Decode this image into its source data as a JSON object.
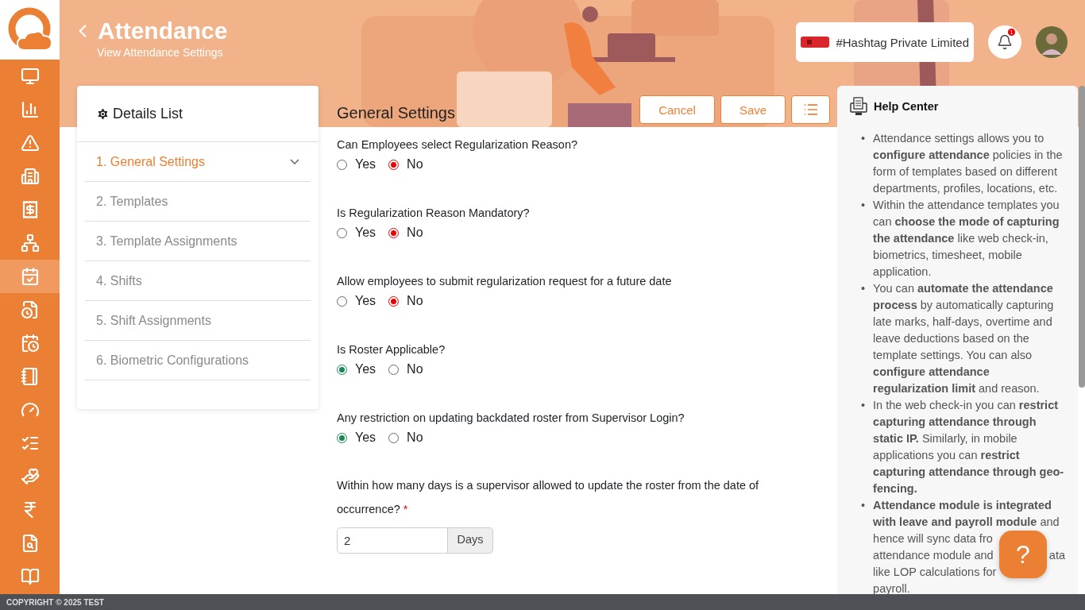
{
  "header": {
    "title": "Attendance",
    "subtitle": "View Attendance Settings",
    "company": "#Hashtag Private Limited",
    "notification_count": "1"
  },
  "nav_items": [
    {
      "selected": false
    },
    {
      "selected": false
    },
    {
      "selected": false
    },
    {
      "selected": false
    },
    {
      "selected": false
    },
    {
      "selected": false
    },
    {
      "selected": true
    },
    {
      "selected": false
    },
    {
      "selected": false
    },
    {
      "selected": false
    },
    {
      "selected": false
    },
    {
      "selected": false
    },
    {
      "selected": false
    },
    {
      "selected": false
    },
    {
      "selected": false
    },
    {
      "selected": false
    }
  ],
  "details": {
    "title": "Details List",
    "items": [
      {
        "label": "1. General Settings",
        "selected": true
      },
      {
        "label": "2. Templates",
        "selected": false
      },
      {
        "label": "3. Template Assignments",
        "selected": false
      },
      {
        "label": "4. Shifts",
        "selected": false
      },
      {
        "label": "5. Shift Assignments",
        "selected": false
      },
      {
        "label": "6. Biometric Configurations",
        "selected": false
      }
    ]
  },
  "form": {
    "title": "General Settings",
    "buttons": [
      "Cancel",
      "Save"
    ],
    "questions": [
      {
        "kind": "radio",
        "label": "Can Employees select Regularization Reason?",
        "options": [
          {
            "label": "Yes",
            "selected": false
          },
          {
            "label": "No",
            "selected": true
          }
        ]
      },
      {
        "kind": "radio",
        "label": "Is Regularization Reason Mandatory?",
        "options": [
          {
            "label": "Yes",
            "selected": false
          },
          {
            "label": "No",
            "selected": true
          }
        ]
      },
      {
        "kind": "radio",
        "label": "Allow employees to submit regularization request for a future date",
        "options": [
          {
            "label": "Yes",
            "selected": false
          },
          {
            "label": "No",
            "selected": true
          }
        ]
      },
      {
        "kind": "radio",
        "label": "Is Roster Applicable?",
        "options": [
          {
            "label": "Yes",
            "selected": true
          },
          {
            "label": "No",
            "selected": false
          }
        ]
      },
      {
        "kind": "radio",
        "label": "Any restriction on updating backdated roster from Supervisor Login?",
        "options": [
          {
            "label": "Yes",
            "selected": true
          },
          {
            "label": "No",
            "selected": false
          }
        ]
      },
      {
        "kind": "number",
        "label": "Within how many days is a supervisor allowed to update the roster from the date of occurrence?",
        "required": "*",
        "value": "2",
        "unit": "Days"
      }
    ]
  },
  "help": {
    "title": "Help Center",
    "items": [
      {
        "bullet": "•",
        "text": "Attendance settings allows you to **configure attendance** policies in the form of templates based on different departments, profiles, locations, etc."
      },
      {
        "bullet": "•",
        "text": "Within the attendance templates you can **choose the mode of capturing the attendance** like web check-in, biometrics, timesheet, mobile application."
      },
      {
        "bullet": "•",
        "text": "You can **automate the attendance process** by automatically capturing late marks, half-days, overtime and leave deductions based on the template settings. You can also **configure attendance regularization limit** and reason."
      },
      {
        "bullet": "•",
        "text": "In the web check-in you can **restrict capturing attendance through static IP.** Similarly, in mobile applications you can **restrict capturing attendance through geo-fencing.**"
      },
      {
        "bullet": "•",
        "lines": [
          [
            "**Attendance module is integrated**"
          ],
          [
            "**with leave and payroll module** and"
          ],
          [
            "hence will sync data fro"
          ],
          [
            "attendance module and",
            "ata"
          ],
          [
            "like LOP calculations for"
          ],
          [
            "payroll."
          ]
        ]
      }
    ]
  },
  "help_button": "?",
  "footer": "COPYRIGHT © 2025 TEST"
}
